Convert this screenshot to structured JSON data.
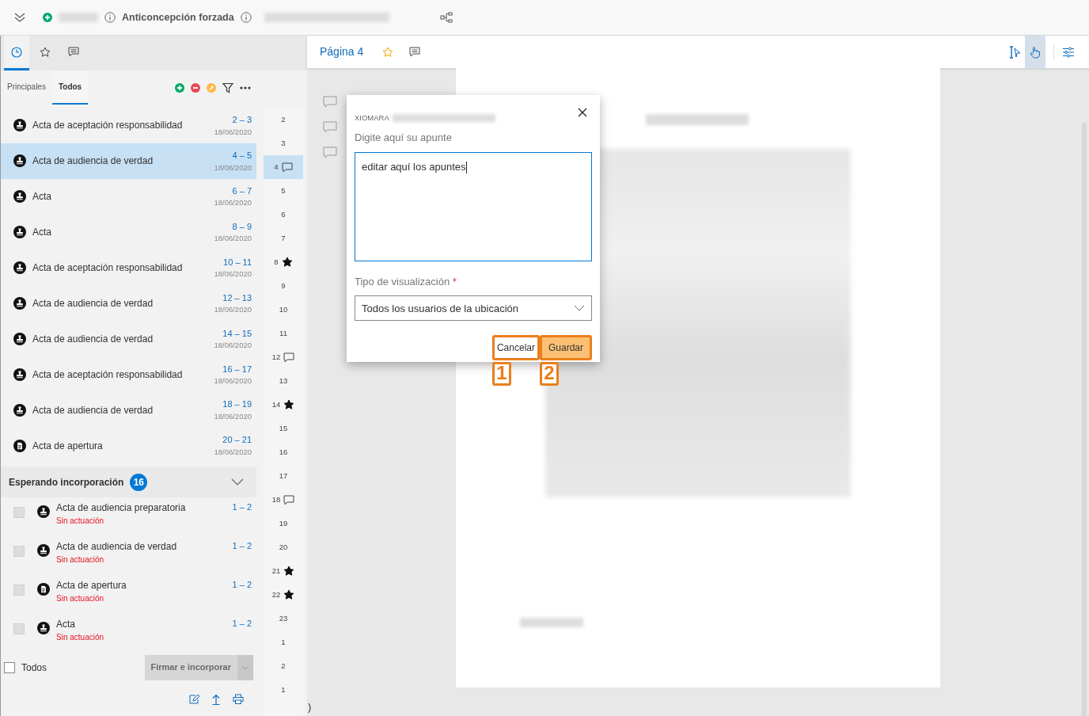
{
  "top_bar": {
    "title": "Anticoncepción forzada"
  },
  "left_tabs": [
    {
      "kind": "history",
      "selected": true
    },
    {
      "kind": "favorites",
      "selected": false
    },
    {
      "kind": "comments",
      "selected": false
    }
  ],
  "sub_tabs": [
    {
      "label": "Principales",
      "selected": false
    },
    {
      "label": "Todos",
      "selected": true
    }
  ],
  "documents": [
    {
      "title": "Acta de aceptación responsabilidad",
      "pages": "2 – 3",
      "date": "18/06/2020",
      "kind": "stamp",
      "selected": false
    },
    {
      "title": "Acta de audiencia de verdad",
      "pages": "4 – 5",
      "date": "18/06/2020",
      "kind": "stamp",
      "selected": true
    },
    {
      "title": "Acta",
      "pages": "6 – 7",
      "date": "18/06/2020",
      "kind": "stamp",
      "selected": false
    },
    {
      "title": "Acta",
      "pages": "8 – 9",
      "date": "18/06/2020",
      "kind": "stamp",
      "selected": false
    },
    {
      "title": "Acta de aceptación responsabilidad",
      "pages": "10 – 11",
      "date": "18/06/2020",
      "kind": "stamp",
      "selected": false
    },
    {
      "title": "Acta de audiencia de verdad",
      "pages": "12 – 13",
      "date": "18/06/2020",
      "kind": "stamp",
      "selected": false
    },
    {
      "title": "Acta de audiencia de verdad",
      "pages": "14 – 15",
      "date": "18/06/2020",
      "kind": "stamp",
      "selected": false
    },
    {
      "title": "Acta de aceptación responsabilidad",
      "pages": "16 – 17",
      "date": "18/06/2020",
      "kind": "stamp",
      "selected": false
    },
    {
      "title": "Acta de audiencia de verdad",
      "pages": "18 – 19",
      "date": "18/06/2020",
      "kind": "stamp",
      "selected": false
    },
    {
      "title": "Acta de apertura",
      "pages": "20 – 21",
      "date": "18/06/2020",
      "kind": "document",
      "selected": false
    }
  ],
  "waiting": {
    "title": "Esperando incorporación",
    "count": "16",
    "expanded": true,
    "items": [
      {
        "title": "Acta de audiencia preparatoria",
        "status": "Sin actuación",
        "pages": "1 – 2",
        "kind": "stamp",
        "checked": false
      },
      {
        "title": "Acta de audiencia de verdad",
        "status": "Sin actuación",
        "pages": "1 – 2",
        "kind": "stamp",
        "checked": false
      },
      {
        "title": "Acta de apertura",
        "status": "Sin actuación",
        "pages": "1 – 2",
        "kind": "document",
        "checked": false
      },
      {
        "title": "Acta",
        "status": "Sin actuación",
        "pages": "1 – 2",
        "kind": "stamp",
        "checked": false
      }
    ]
  },
  "footer": {
    "select_all": {
      "label": "Todos",
      "checked": false
    },
    "action_button": {
      "label": "Firmar e incorporar",
      "disabled": true
    }
  },
  "thumbnails": [
    {
      "number": "2",
      "kind": "none",
      "selected": false
    },
    {
      "number": "3",
      "kind": "none",
      "selected": false
    },
    {
      "number": "4",
      "kind": "comment",
      "selected": true
    },
    {
      "number": "5",
      "kind": "none",
      "selected": false
    },
    {
      "number": "6",
      "kind": "none",
      "selected": false
    },
    {
      "number": "7",
      "kind": "none",
      "selected": false
    },
    {
      "number": "8",
      "kind": "star",
      "selected": false
    },
    {
      "number": "9",
      "kind": "none",
      "selected": false
    },
    {
      "number": "10",
      "kind": "none",
      "selected": false
    },
    {
      "number": "11",
      "kind": "none",
      "selected": false
    },
    {
      "number": "12",
      "kind": "comment",
      "selected": false
    },
    {
      "number": "13",
      "kind": "none",
      "selected": false
    },
    {
      "number": "14",
      "kind": "star",
      "selected": false
    },
    {
      "number": "15",
      "kind": "none",
      "selected": false
    },
    {
      "number": "16",
      "kind": "none",
      "selected": false
    },
    {
      "number": "17",
      "kind": "none",
      "selected": false
    },
    {
      "number": "18",
      "kind": "comment",
      "selected": false
    },
    {
      "number": "19",
      "kind": "none",
      "selected": false
    },
    {
      "number": "20",
      "kind": "none",
      "selected": false
    },
    {
      "number": "21",
      "kind": "star",
      "selected": false
    },
    {
      "number": "22",
      "kind": "star",
      "selected": false
    },
    {
      "number": "23",
      "kind": "none",
      "selected": false
    },
    {
      "number": "1",
      "kind": "none",
      "selected": false
    },
    {
      "number": "2",
      "kind": "none",
      "selected": false
    },
    {
      "number": "1",
      "kind": "none",
      "selected": false
    }
  ],
  "viewer": {
    "page_title": "Página 4",
    "tools": [
      {
        "kind": "text-select",
        "selected": false
      },
      {
        "kind": "hand",
        "selected": true
      }
    ],
    "stray_text": ")"
  },
  "note_dialog": {
    "author": "XIOMARA",
    "note_label": "Digite aquí su apunte",
    "note_value": "editar aquí los apuntes",
    "visibility_label": "Tipo de visualización",
    "required_mark": "*",
    "visibility_value": "Todos los usuarios de la ubicación",
    "buttons": [
      {
        "label": "Cancelar",
        "kind": "secondary",
        "callout": "1"
      },
      {
        "label": "Guardar",
        "kind": "primary",
        "callout": "2"
      }
    ]
  }
}
